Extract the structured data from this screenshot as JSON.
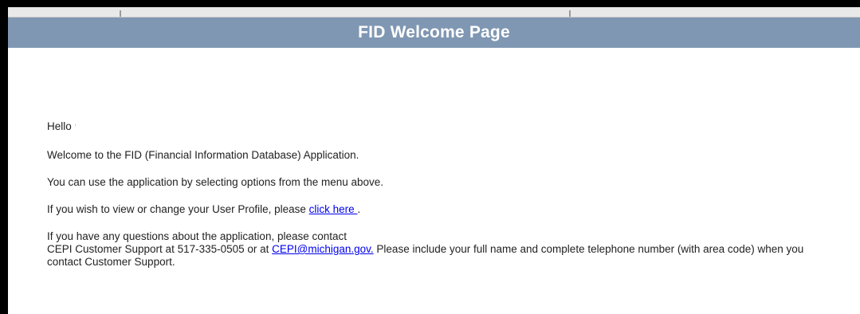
{
  "header": {
    "title": "FID Welcome Page"
  },
  "content": {
    "greeting": "Hello",
    "greeting_suffix": "'",
    "welcome": "Welcome to the FID (Financial Information Database) Application.",
    "menu_hint": "You can use the application by selecting options from the menu above.",
    "profile_prefix": "If you wish to view or change your User Profile, please ",
    "profile_link": "click here ",
    "profile_suffix": ".",
    "contact_line1": "If you have any questions about the application, please contact",
    "contact_prefix": "CEPI Customer Support at 517-335-0505 or at ",
    "contact_email": "CEPI@michigan.gov.",
    "contact_suffix": " Please include your full name and complete telephone number (with area code) when you contact Customer Support."
  },
  "colors": {
    "header_bg": "#7f97b2",
    "header_text": "#ffffff",
    "link": "#0000ee"
  }
}
